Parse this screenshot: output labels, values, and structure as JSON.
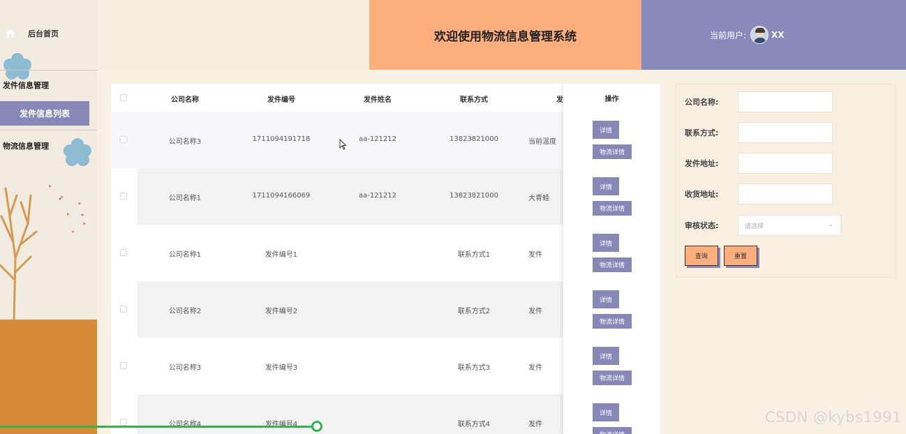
{
  "sidebar": {
    "home_label": "后台首页",
    "group1": "发件信息管理",
    "active_item": "发件信息列表",
    "group2": "物流信息管理"
  },
  "header": {
    "title": "欢迎使用物流信息管理系统",
    "user_label": "当前用户:",
    "username": "XX"
  },
  "table": {
    "columns": [
      "公司名称",
      "发件编号",
      "发件姓名",
      "联系方式",
      "发",
      "操作"
    ],
    "rows": [
      {
        "company": "公司名称3",
        "code": "1711094191718",
        "name": "aa-121212",
        "contact": "13823821000",
        "extra": "当前温度"
      },
      {
        "company": "公司名称1",
        "code": "1711094166069",
        "name": "aa-121212",
        "contact": "13823821000",
        "extra": "大青蛙"
      },
      {
        "company": "公司名称1",
        "code": "发件编号1",
        "name": "",
        "contact": "联系方式1",
        "extra": "发件"
      },
      {
        "company": "公司名称2",
        "code": "发件编号2",
        "name": "",
        "contact": "联系方式2",
        "extra": "发件"
      },
      {
        "company": "公司名称3",
        "code": "发件编号3",
        "name": "",
        "contact": "联系方式3",
        "extra": "发件"
      },
      {
        "company": "公司名称4",
        "code": "发件编号4",
        "name": "",
        "contact": "联系方式4",
        "extra": "发件"
      }
    ],
    "detail_label": "详情",
    "logistics_label": "物流详情"
  },
  "search": {
    "company_label": "公司名称:",
    "contact_label": "联系方式:",
    "send_addr_label": "发件地址:",
    "recv_addr_label": "收货地址:",
    "status_label": "审核状态:",
    "status_placeholder": "请选择",
    "query_label": "查询",
    "reset_label": "重置"
  },
  "overlay": {
    "watermark": "CSDN @kybs1991",
    "progress": 0.35
  },
  "colors": {
    "accent_purple": "#8888b8",
    "accent_orange": "#fcaf7d",
    "progress_green": "#2fb54e"
  }
}
